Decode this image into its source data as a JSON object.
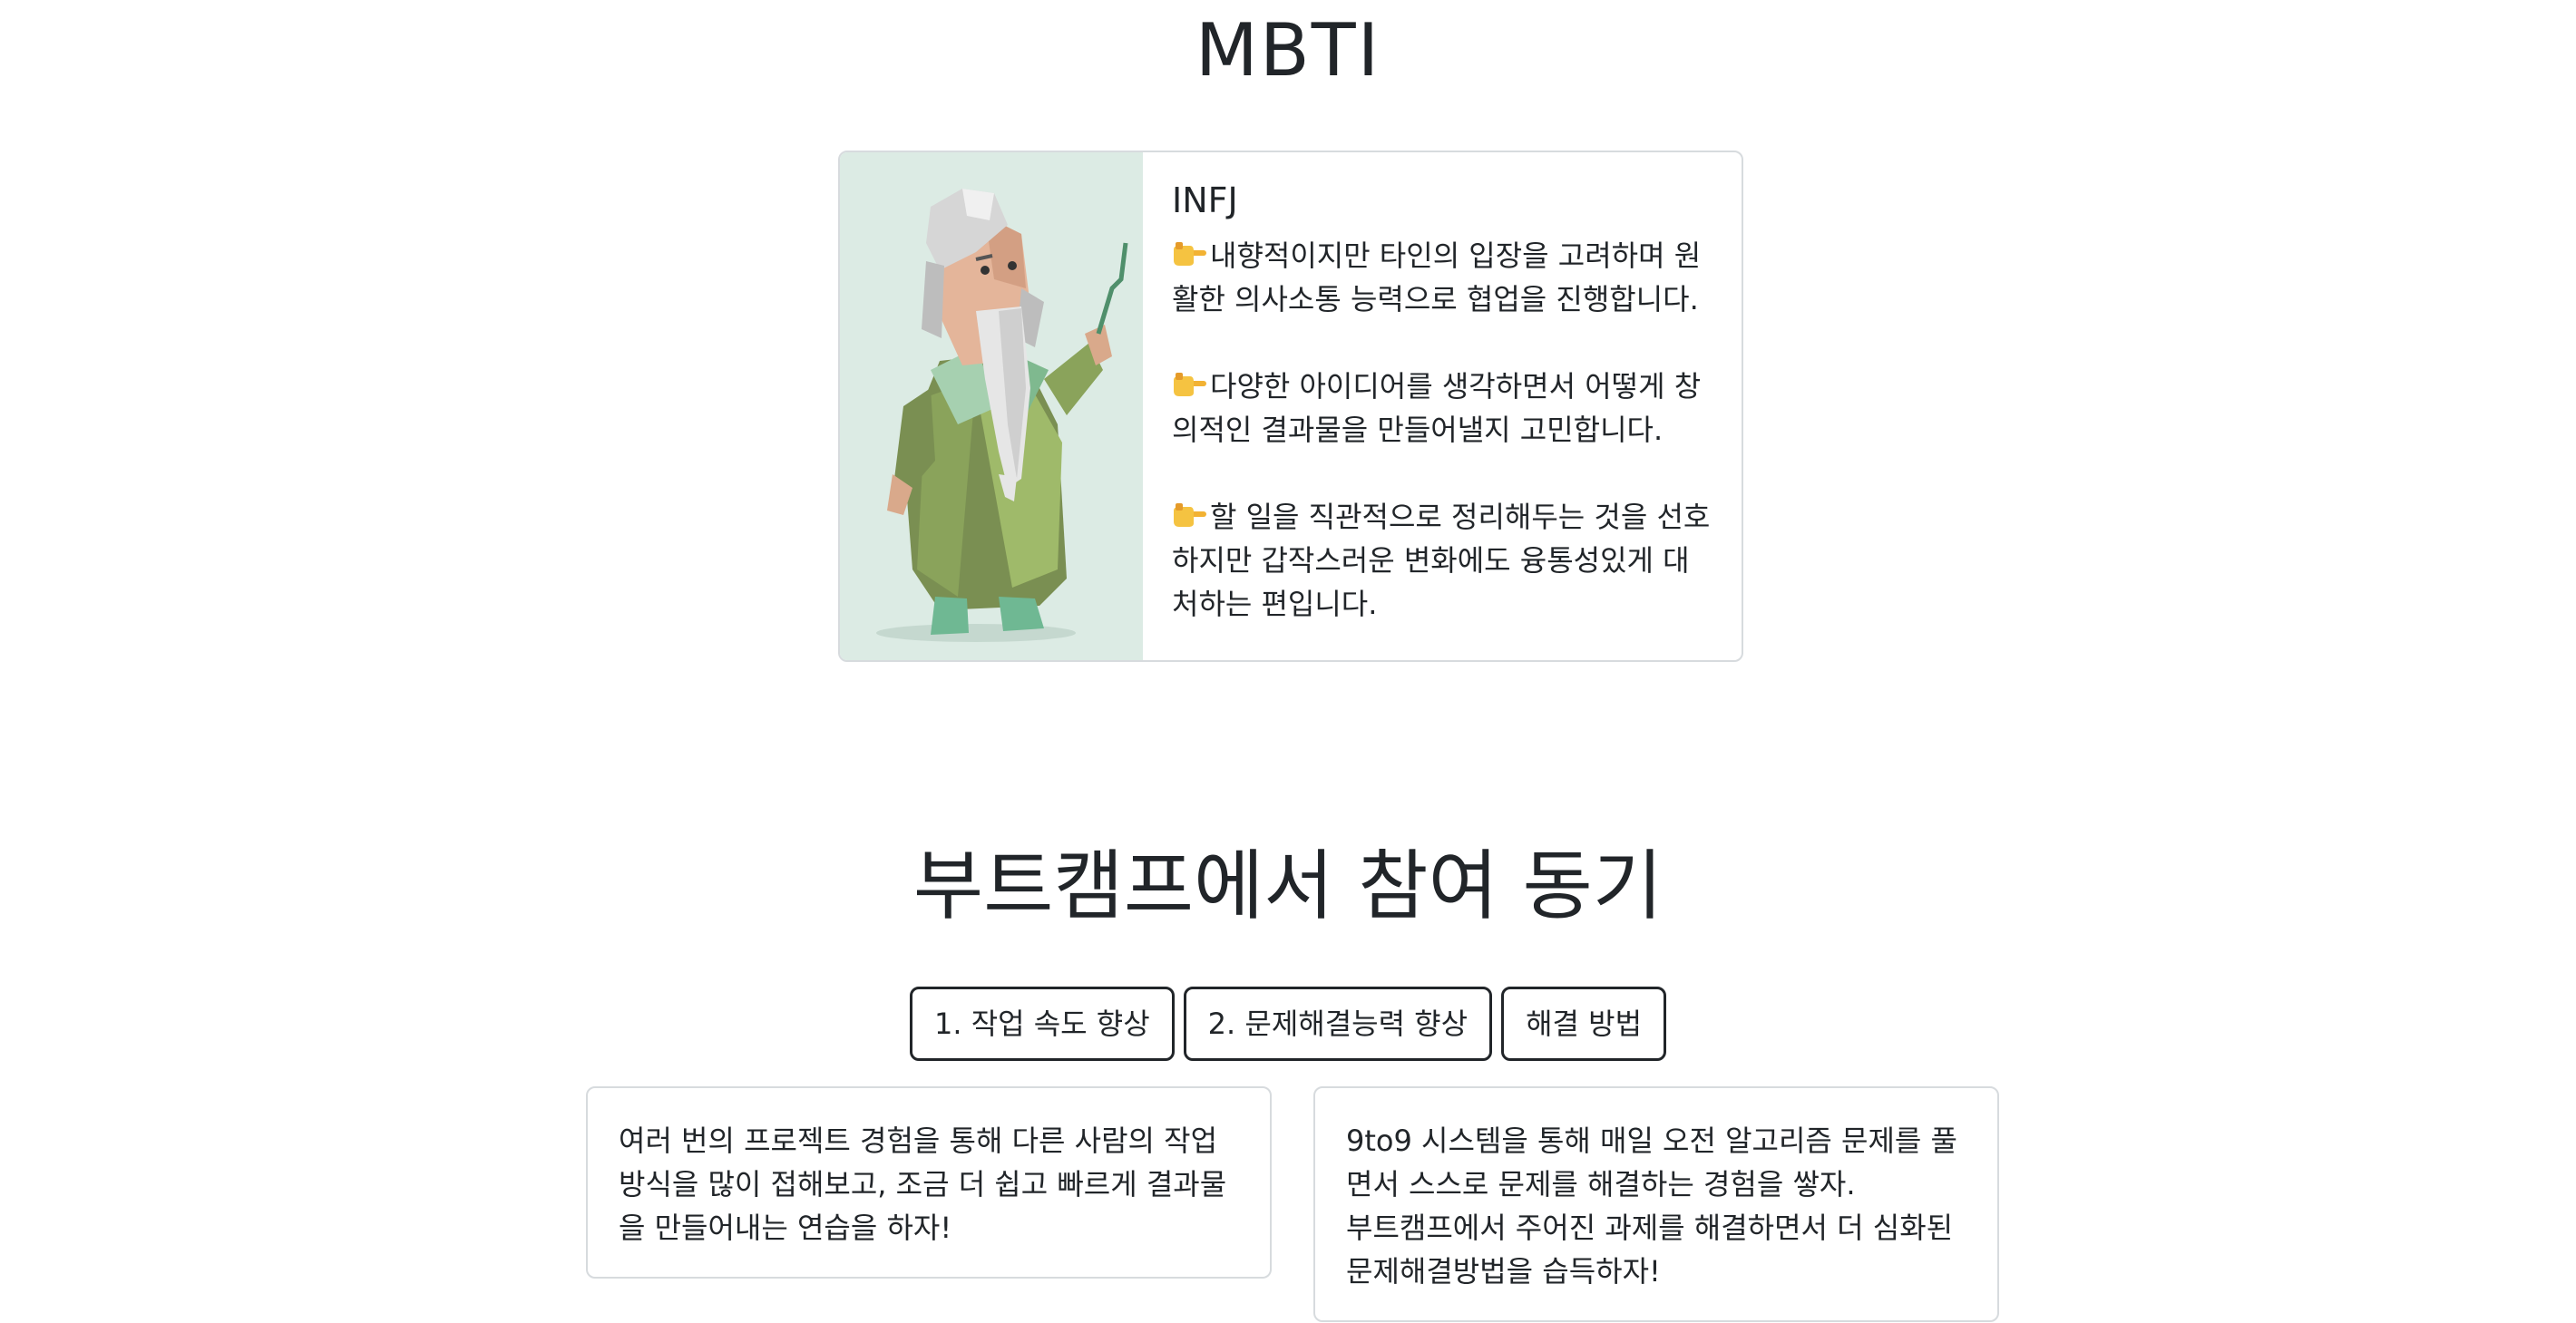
{
  "page": {
    "title": "MBTI"
  },
  "mbti": {
    "type": "INFJ",
    "image_subject": "wizard-illustration",
    "descriptions": [
      "내향적이지만 타인의 입장을 고려하며 원활한 의사소통 능력으로 협업을 진행합니다.",
      "다양한 아이디어를 생각하면서 어떻게 창의적인 결과물을 만들어낼지 고민합니다.",
      "할 일을 직관적으로 정리해두는 것을 선호하지만 갑작스러운 변화에도 융통성있게 대처하는 편입니다."
    ],
    "bullet_icon": "pointing-hand-icon",
    "image_bg_color": "#dcebe4"
  },
  "motivation": {
    "title": "부트캠프에서 참여 동기",
    "tabs": [
      "1. 작업 속도 향상",
      "2. 문제해결능력 향상",
      "해결 방법"
    ],
    "cards": [
      [
        "여러 번의 프로젝트 경험을 통해 다른 사람의 작업 방식을 많이 접해보고, 조금 더 쉽고 빠르게 결과물을 만들어내는 연습을 하자!"
      ],
      [
        "9to9 시스템을 통해 매일 오전 알고리즘 문제를 풀면서 스스로 문제를 해결하는 경험을 쌓자.",
        "부트캠프에서 주어진 과제를 해결하면서 더 심화된 문제해결방법을 습득하자!"
      ]
    ]
  }
}
